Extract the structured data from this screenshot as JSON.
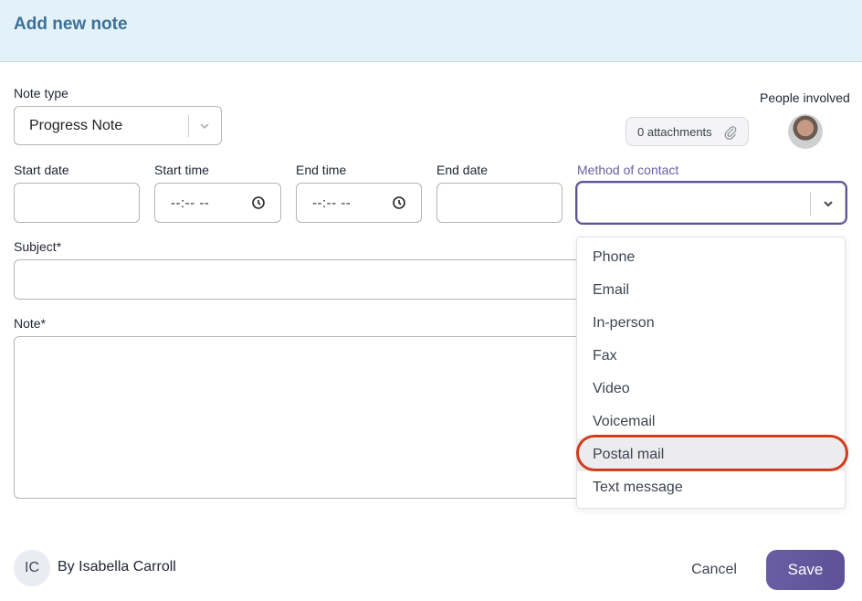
{
  "header": {
    "title": "Add new note"
  },
  "note_type": {
    "label": "Note type",
    "value": "Progress Note"
  },
  "attachments": {
    "label": "0 attachments"
  },
  "people": {
    "label": "People involved"
  },
  "start_date": {
    "label": "Start date",
    "value": ""
  },
  "start_time": {
    "label": "Start time",
    "value": "--:-- --"
  },
  "end_time": {
    "label": "End time",
    "value": "--:-- --"
  },
  "end_date": {
    "label": "End date",
    "value": ""
  },
  "method": {
    "label": "Method of contact",
    "value": "",
    "options": [
      "Phone",
      "Email",
      "In-person",
      "Fax",
      "Video",
      "Voicemail",
      "Postal mail",
      "Text message"
    ],
    "highlighted": "Postal mail"
  },
  "subject": {
    "label": "Subject",
    "required": "*",
    "value": ""
  },
  "note": {
    "label": "Note",
    "required": "*",
    "value": ""
  },
  "author": {
    "initials": "IC",
    "byline": "By Isabella Carroll"
  },
  "actions": {
    "cancel": "Cancel",
    "save": "Save"
  },
  "colors": {
    "accent": "#6a5ea3",
    "header_bg": "#e3f2f9",
    "title": "#3d6f98",
    "highlight_ring": "#d13d1a"
  }
}
